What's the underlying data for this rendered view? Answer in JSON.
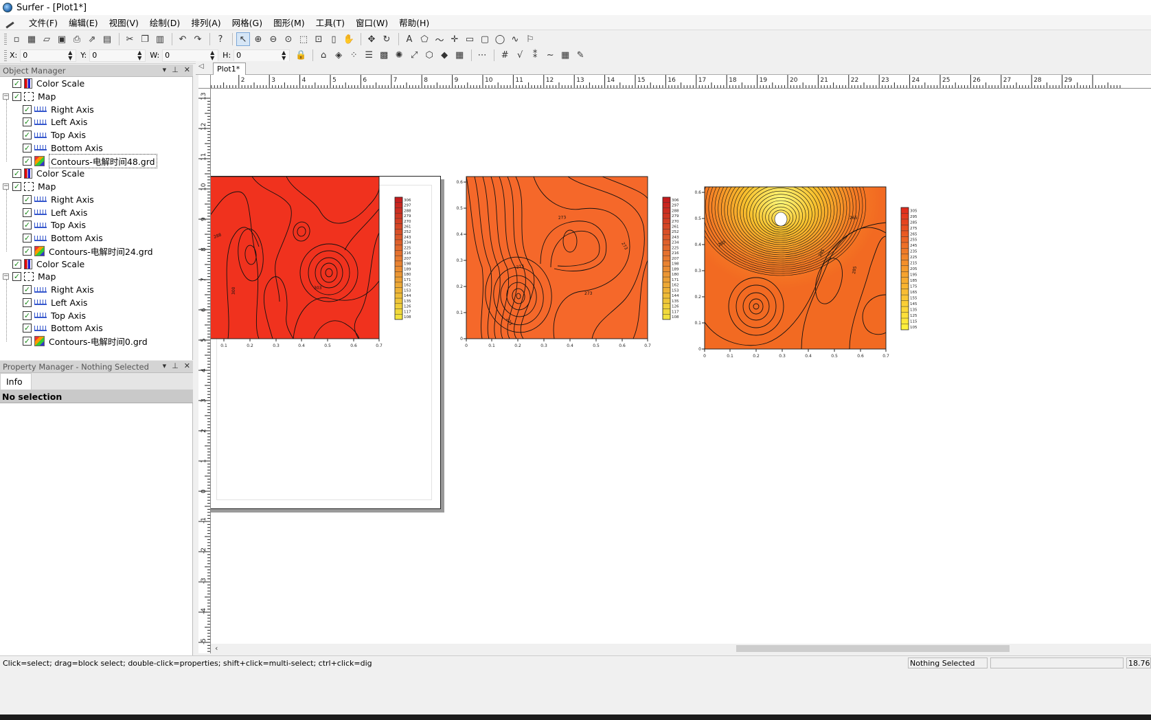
{
  "window": {
    "title": "Surfer - [Plot1*]"
  },
  "menu": [
    "文件(F)",
    "编辑(E)",
    "视图(V)",
    "绘制(D)",
    "排列(A)",
    "网格(G)",
    "图形(M)",
    "工具(T)",
    "窗口(W)",
    "帮助(H)"
  ],
  "coords": {
    "x_label": "X:",
    "x_value": "0",
    "y_label": "Y:",
    "y_value": "0",
    "w_label": "W:",
    "w_value": "0",
    "h_label": "H:",
    "h_value": "0"
  },
  "object_manager": {
    "title": "Object Manager",
    "items": [
      {
        "label": "Color Scale",
        "icon": "color-scale-icon"
      },
      {
        "label": "Map",
        "icon": "map-icon"
      },
      {
        "label": "Right Axis",
        "icon": "axis-icon"
      },
      {
        "label": "Left Axis",
        "icon": "axis-icon"
      },
      {
        "label": "Top Axis",
        "icon": "axis-icon"
      },
      {
        "label": "Bottom Axis",
        "icon": "axis-icon"
      },
      {
        "label": "Contours-电解时间48.grd",
        "icon": "contour-icon"
      },
      {
        "label": "Color Scale",
        "icon": "color-scale-icon"
      },
      {
        "label": "Map",
        "icon": "map-icon"
      },
      {
        "label": "Right Axis",
        "icon": "axis-icon"
      },
      {
        "label": "Left Axis",
        "icon": "axis-icon"
      },
      {
        "label": "Top Axis",
        "icon": "axis-icon"
      },
      {
        "label": "Bottom Axis",
        "icon": "axis-icon"
      },
      {
        "label": "Contours-电解时间24.grd",
        "icon": "contour-icon"
      },
      {
        "label": "Color Scale",
        "icon": "color-scale-icon"
      },
      {
        "label": "Map",
        "icon": "map-icon"
      },
      {
        "label": "Right Axis",
        "icon": "axis-icon"
      },
      {
        "label": "Left Axis",
        "icon": "axis-icon"
      },
      {
        "label": "Top Axis",
        "icon": "axis-icon"
      },
      {
        "label": "Bottom Axis",
        "icon": "axis-icon"
      },
      {
        "label": "Contours-电解时间0.grd",
        "icon": "contour-icon"
      }
    ]
  },
  "property_manager": {
    "title": "Property Manager - Nothing Selected",
    "tab": "Info",
    "header": "No selection"
  },
  "document": {
    "tab": "Plot1*"
  },
  "rulers": {
    "horizontal": [
      "2",
      "3",
      "4",
      "5",
      "6",
      "7",
      "8",
      "9",
      "10",
      "11",
      "12",
      "13",
      "14",
      "15",
      "16",
      "17",
      "18",
      "19",
      "20",
      "21",
      "22",
      "23",
      "24",
      "25",
      "26",
      "27",
      "28",
      "29"
    ],
    "vertical": [
      "13",
      "12",
      "11",
      "10",
      "9",
      "8",
      "7",
      "6",
      "5",
      "4",
      "3",
      "2",
      "1",
      "0",
      "-1",
      "-2",
      "-3",
      "-4",
      "-5"
    ]
  },
  "maps": [
    {
      "x_ticks": [
        "0.1",
        "0.2",
        "0.3",
        "0.4",
        "0.5",
        "0.6",
        "0.7"
      ],
      "scale_labels": [
        "306",
        "297",
        "288",
        "279",
        "270",
        "261",
        "252",
        "243",
        "234",
        "225",
        "216",
        "207",
        "198",
        "189",
        "180",
        "171",
        "162",
        "153",
        "144",
        "135",
        "126",
        "117",
        "108"
      ],
      "contour_labels": [
        "288",
        "300",
        "303"
      ]
    },
    {
      "x_ticks": [
        "0",
        "0.1",
        "0.2",
        "0.3",
        "0.4",
        "0.5",
        "0.6",
        "0.7"
      ],
      "y_ticks": [
        "0.6",
        "0.5",
        "0.4",
        "0.3",
        "0.2",
        "0.1",
        "0"
      ],
      "scale_labels": [
        "306",
        "297",
        "288",
        "279",
        "270",
        "261",
        "252",
        "243",
        "234",
        "225",
        "216",
        "207",
        "198",
        "189",
        "180",
        "171",
        "162",
        "153",
        "144",
        "135",
        "126",
        "117",
        "108"
      ],
      "contour_labels": [
        "273",
        "273",
        "273",
        "273",
        "273"
      ]
    },
    {
      "x_ticks": [
        "0",
        "0.1",
        "0.2",
        "0.3",
        "0.4",
        "0.5",
        "0.6",
        "0.7"
      ],
      "y_ticks": [
        "0.6",
        "0.5",
        "0.4",
        "0.3",
        "0.2",
        "0.1",
        "0"
      ],
      "scale_labels": [
        "305",
        "295",
        "285",
        "275",
        "265",
        "255",
        "245",
        "235",
        "225",
        "215",
        "205",
        "195",
        "185",
        "175",
        "165",
        "155",
        "145",
        "135",
        "125",
        "115",
        "105"
      ],
      "contour_labels": [
        "265",
        "265",
        "285",
        "285"
      ]
    }
  ],
  "status": {
    "hint": "Click=select; drag=block select; double-click=properties; shift+click=multi-select; ctrl+click=dig",
    "selection": "Nothing Selected",
    "size": "18.76 in"
  },
  "colors": {
    "map_red": "#f0321e",
    "map_orange": "#f5682a",
    "yellow": "#fff23a",
    "panel_gray": "#d4d4d4"
  }
}
